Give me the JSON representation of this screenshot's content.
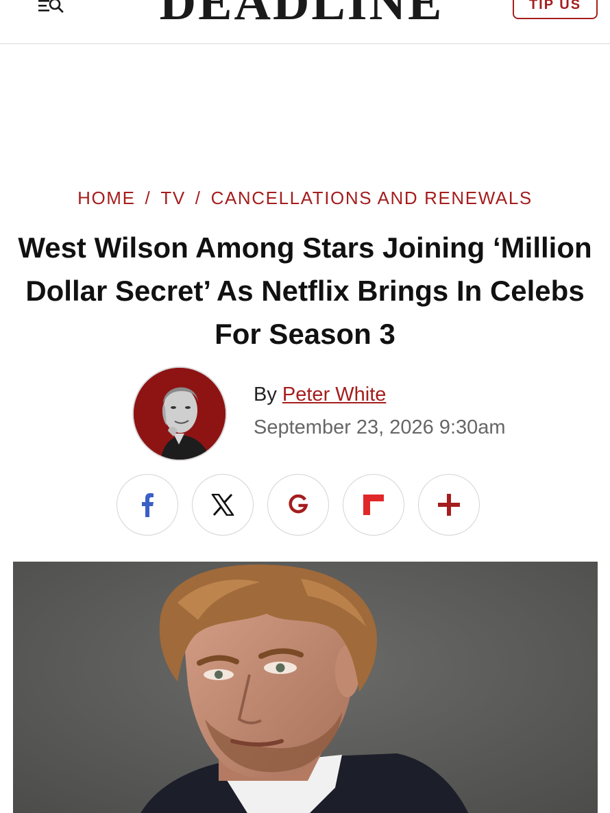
{
  "header": {
    "logo_text": "DEADLINE",
    "tip_button_label": "TIP US"
  },
  "breadcrumb": {
    "items": [
      {
        "label": "HOME"
      },
      {
        "label": "TV"
      },
      {
        "label": "CANCELLATIONS AND RENEWALS"
      }
    ],
    "separator": "/"
  },
  "article": {
    "title": "West Wilson Among Stars Joining ‘Million Dollar Secret’ As Netflix Brings In Celebs For Season 3",
    "byline_prefix": "By",
    "author": "Peter White",
    "date": "September 23, 2026 9:30am"
  },
  "share": {
    "buttons": [
      "facebook-icon",
      "x-icon",
      "google-icon",
      "flipboard-icon",
      "plus-icon"
    ]
  },
  "colors": {
    "accent": "#a51d1d",
    "facebook": "#3b5fc8",
    "flipboard": "#e12828"
  }
}
